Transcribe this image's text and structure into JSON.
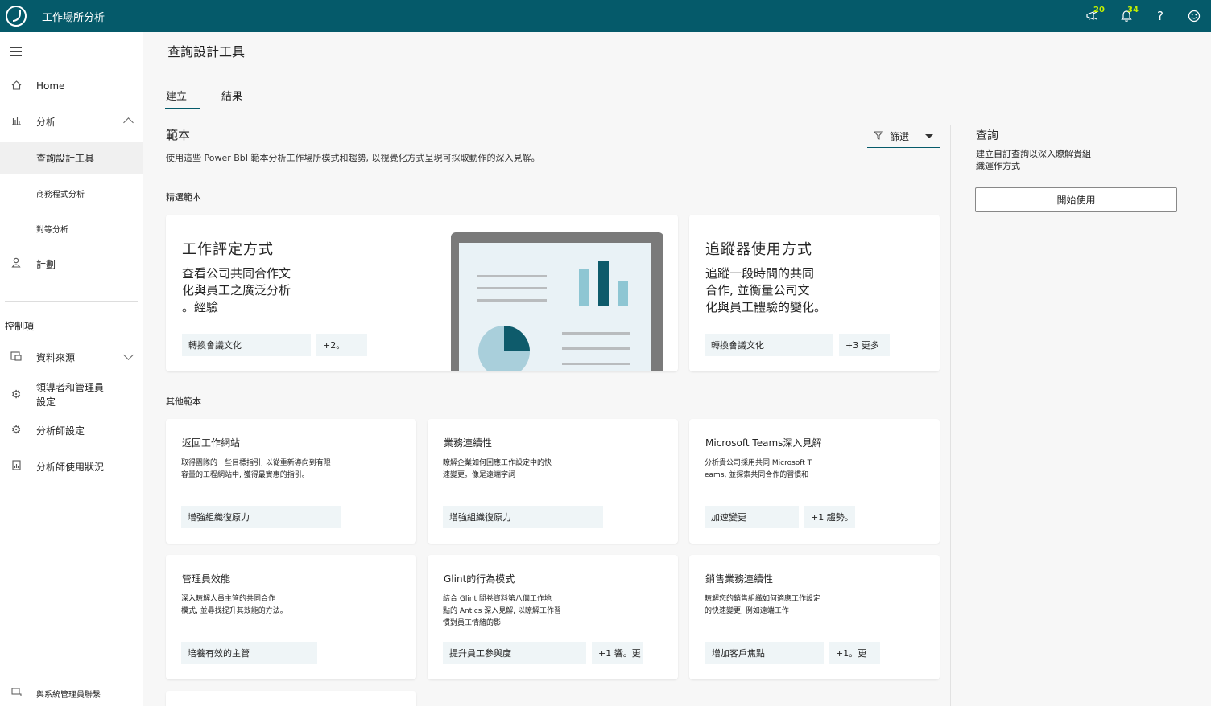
{
  "topbar": {
    "app_title": "工作場所分析",
    "icons": [
      {
        "name": "megaphone-icon",
        "badge": "20"
      },
      {
        "name": "bell-icon",
        "badge": "34"
      },
      {
        "name": "help-icon",
        "glyph": "?"
      },
      {
        "name": "smiley-icon",
        "glyph": "☺"
      }
    ]
  },
  "sidebar": {
    "home": "Home",
    "analyze": "分析",
    "query_designer": "查詢設計工具",
    "business_analysis": "商務程式分析",
    "peer_analysis": "對等分析",
    "plans": "計劃",
    "controls_label": "控制項",
    "data_sources": "資料來源",
    "leaders_managers": "領導者和管理員設定",
    "analyst_settings": "分析師設定",
    "analyst_usage": "分析師使用狀況",
    "contact_admin": "與系統管理員聯繫"
  },
  "main": {
    "page_title": "查詢設計工具",
    "tabs": [
      "建立",
      "結果"
    ],
    "templates_heading": "範本",
    "templates_desc": "使用這些 Power BbI 範本分析工作場所模式和趨勢, 以視覺化方式呈現可採取動作的深入見解。",
    "filter_label": "篩選",
    "featured_heading": "精選範本",
    "other_heading": "其他範本"
  },
  "featured": [
    {
      "title": "工作評定方式",
      "body_lines": [
        "查看公司共同合作文",
        "化與員工之廣泛分析",
        "。經驗"
      ],
      "tag": "轉換會議文化",
      "more": "+2。"
    },
    {
      "title": "追蹤器使用方式",
      "body_lines": [
        "追蹤一段時間的共同",
        "合作, 並衡量公司文",
        "化與員工體驗的變化。"
      ],
      "tag": "轉換會議文化",
      "more": "+3 更多"
    }
  ],
  "others": [
    {
      "title": "返回工作網站",
      "body_lines": [
        "取得團隊的一些目標指引, 以從重新導向到有限",
        "容量的工程網站中, 獲得最實惠的指引。"
      ],
      "tag": "增強組織復原力",
      "more": ""
    },
    {
      "title": "業務連續性",
      "body_lines": [
        "瞭解企業如何回應工作設定中的快",
        "速變更。像是遠端字詞"
      ],
      "tag": "增強組織復原力",
      "more": ""
    },
    {
      "title": "Microsoft Teams深入見解",
      "body_lines": [
        "分析貴公司採用共同 Microsoft T",
        "eams, 並探索共同合作的習慣和"
      ],
      "tag": "加速變更",
      "more": "+1 趨勢。"
    },
    {
      "title": "管理員效能",
      "body_lines": [
        "深入瞭解人員主管的共同合作",
        "模式, 並尋找提升其效能的方法。"
      ],
      "tag": "培養有效的主管",
      "more": ""
    },
    {
      "title": "Glint的行為模式",
      "body_lines": [
        "結合 Glint 問卷資料第八個工作地",
        "點的 Antics 深入見解, 以瞭解工作習",
        "慣對員工情緒的影"
      ],
      "tag": "提升員工參與度",
      "more": "+1 響。更"
    },
    {
      "title": "銷售業務連續性",
      "body_lines": [
        "瞭解您的銷售組織如何適應工作設定",
        "的快速變更, 例如遠端工作"
      ],
      "tag": "增加客戶焦點",
      "more": "+1。更"
    }
  ],
  "right_panel": {
    "title": "查詢",
    "desc": "建立自訂查詢以深入瞭解貴組織運作方式",
    "button": "開始使用"
  }
}
